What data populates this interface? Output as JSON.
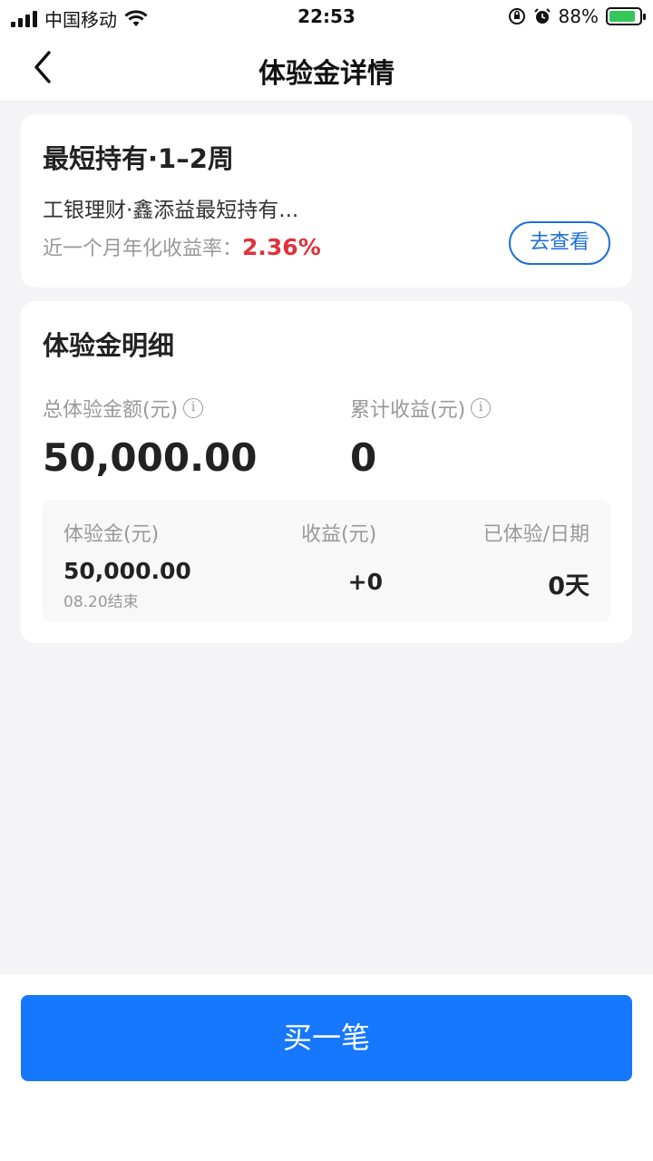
{
  "status_bar": {
    "carrier": "中国移动",
    "time": "22:53",
    "battery": "88%",
    "battery_level": 0.88,
    "icons": [
      "signal-icon",
      "wifi-icon",
      "orientation-lock-icon",
      "alarm-icon",
      "battery-icon"
    ]
  },
  "nav": {
    "title": "体验金详情",
    "back_icon": "chevron-left-icon"
  },
  "product": {
    "title": "最短持有·1–2周",
    "name": "工银理财·鑫添益最短持有...",
    "rate_label": "近一个月年化收益率：",
    "rate_value": "2.36%",
    "view_button": "去查看"
  },
  "detail": {
    "title": "体验金明细",
    "total_label": "总体验金额(元)",
    "total_value": "50,000.00",
    "income_label": "累计收益(元)",
    "income_value": "0",
    "table": {
      "headers": [
        "体验金(元)",
        "收益(元)",
        "已体验/日期"
      ],
      "amount": "50,000.00",
      "end_date": "08.20结束",
      "income": "+0",
      "days": "0天"
    }
  },
  "buy_button": "买一笔",
  "colors": {
    "accent_blue": "#1677ff",
    "rate_red": "#e0323a",
    "background": "#f4f4f6"
  }
}
